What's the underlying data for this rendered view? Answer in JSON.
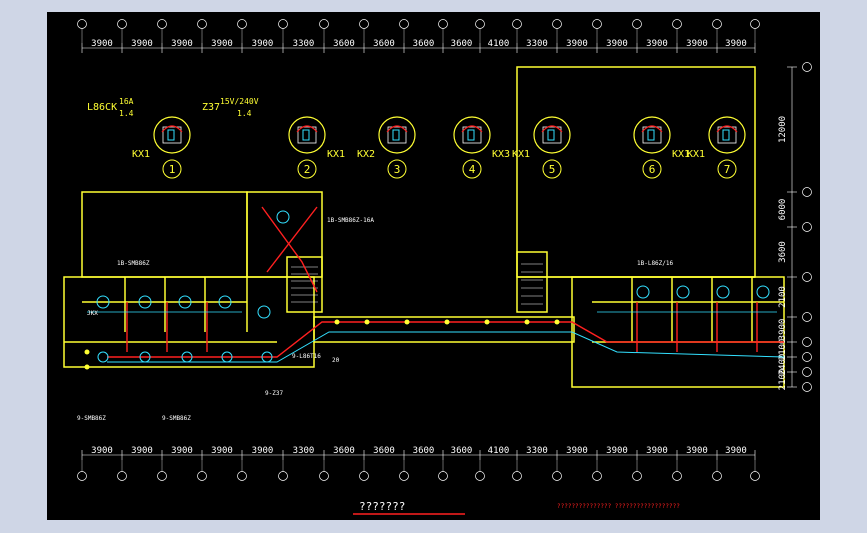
{
  "colors": {
    "background": "#000000",
    "wall": "#ffff33",
    "wire_red": "#ff2020",
    "wire_cyan": "#33e0ff",
    "dim_line": "#ffffff",
    "axis_bubble": "#ffffff",
    "title_underline": "#ff2020",
    "footer_red": "#ff2020"
  },
  "dimensions": {
    "top": [
      "3900",
      "3900",
      "3900",
      "3900",
      "3900",
      "3300",
      "3600",
      "3600",
      "3600",
      "3600",
      "4100",
      "3300",
      "3900",
      "3900",
      "3900",
      "3900",
      "3900"
    ],
    "bottom": [
      "3900",
      "3900",
      "3900",
      "3900",
      "3900",
      "3300",
      "3600",
      "3600",
      "3600",
      "3600",
      "4100",
      "3300",
      "3900",
      "3900",
      "3900",
      "3900",
      "3900"
    ],
    "right": [
      "12000",
      "6000",
      "3600",
      "2100",
      "3900",
      "2100",
      "2400",
      "2100"
    ]
  },
  "detail_symbols": {
    "label_left_1": "L86CK",
    "label_left_2": "16A",
    "label_left_3": "1.4",
    "label_right_1": "Z37",
    "label_right_2": "15V/240V",
    "label_right_3": "1.4",
    "switch_labels": [
      "KX1",
      "KX1",
      "KX2",
      "KX3",
      "KX1",
      "KX1",
      "KX1"
    ],
    "numbers": [
      "1",
      "2",
      "3",
      "4",
      "5",
      "6",
      "7"
    ]
  },
  "annotations": {
    "upper_left_note": "1B-SMB86Z-16A",
    "center_note": "1B-SMB86Z",
    "right_note": "1B-L86Z/16",
    "bottom_note_1": "9-SMB86Z",
    "bottom_note_2": "9-Z37",
    "bottom_note_3": "9-SMB86Z",
    "mid_note": "9-L86T16",
    "mid_value": "20",
    "jkx": "JKX"
  },
  "title": "???????",
  "footer_legend": "???????????????      ??????????????????"
}
